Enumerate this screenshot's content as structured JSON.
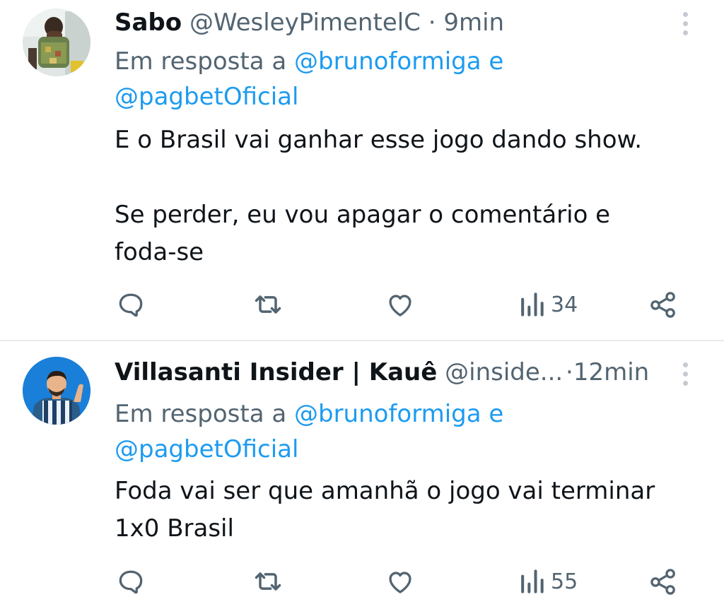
{
  "tweets": [
    {
      "name": "Sabo",
      "handle": "@WesleyPimentelC",
      "separator": "·",
      "time": "9min",
      "reply_prefix": "Em resposta a",
      "reply_mention_1": "@brunoformiga",
      "reply_joiner": "e",
      "reply_mention_2": "@pagbetOficial",
      "text_lines": [
        "E o Brasil vai ganhar esse jogo dando show.",
        "",
        "Se perder, eu vou apagar o comentário e",
        "foda-se"
      ],
      "views": "34",
      "icons": {
        "avatar": "user-avatar-photo",
        "more": "more-vertical-icon",
        "reply": "reply-icon",
        "retweet": "retweet-icon",
        "like": "heart-icon",
        "views": "views-bar-chart-icon",
        "share": "share-icon"
      }
    },
    {
      "name": "Villasanti Insider | Kauê",
      "handle": "@inside...",
      "separator": "·",
      "time": "12min",
      "reply_prefix": "Em resposta a",
      "reply_mention_1": "@brunoformiga",
      "reply_joiner": "e",
      "reply_mention_2": "@pagbetOficial",
      "text_lines": [
        "Foda vai ser que amanhã o jogo vai terminar",
        "1x0 Brasil"
      ],
      "views": "55",
      "icons": {
        "avatar": "user-avatar-illustration",
        "more": "more-vertical-icon",
        "reply": "reply-icon",
        "retweet": "retweet-icon",
        "like": "heart-icon",
        "views": "views-bar-chart-icon",
        "share": "share-icon"
      }
    }
  ],
  "colors": {
    "text": "#0f1419",
    "secondary": "#536471",
    "link": "#1d9bf0",
    "divider": "#e7eaed"
  }
}
